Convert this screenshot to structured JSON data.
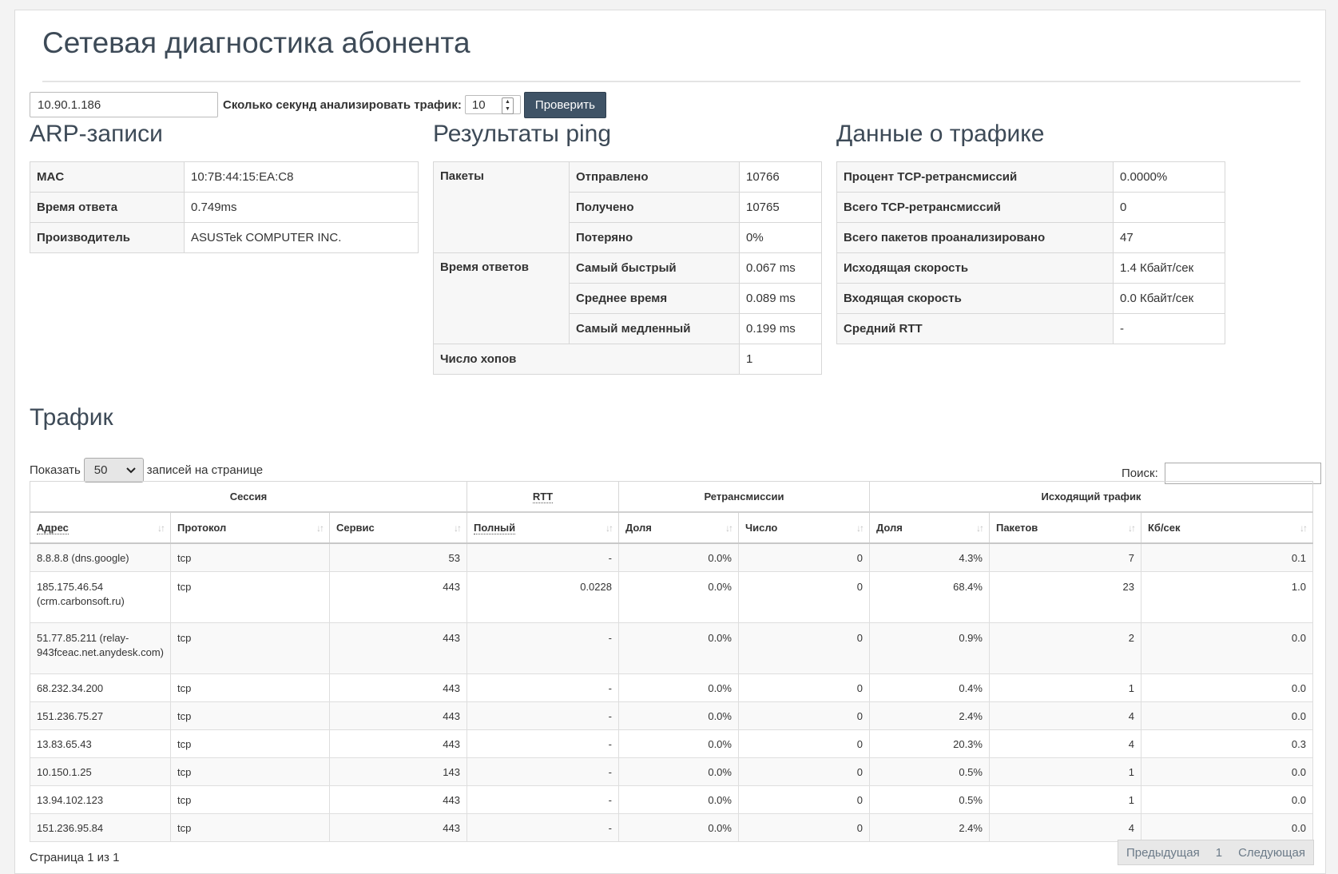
{
  "page": {
    "title": "Сетевая диагностика абонента"
  },
  "form": {
    "ip_value": "10.90.1.186",
    "seconds_label": "Сколько секунд анализировать трафик:",
    "seconds_value": "10",
    "check_label": "Проверить"
  },
  "arp": {
    "title": "ARP-записи",
    "rows": [
      {
        "label": "MAC",
        "value": "10:7B:44:15:EA:C8"
      },
      {
        "label": "Время ответа",
        "value": "0.749ms"
      },
      {
        "label": "Производитель",
        "value": "ASUSTek COMPUTER INC."
      }
    ]
  },
  "ping": {
    "title": "Результаты ping",
    "packets_label": "Пакеты",
    "sent_label": "Отправлено",
    "sent": "10766",
    "received_label": "Получено",
    "received": "10765",
    "lost_label": "Потеряно",
    "lost": "0%",
    "times_label": "Время ответов",
    "fastest_label": "Самый быстрый",
    "fastest": "0.067 ms",
    "avg_label": "Среднее время",
    "avg": "0.089 ms",
    "slowest_label": "Самый медленный",
    "slowest": "0.199 ms",
    "hops_label": "Число хопов",
    "hops": "1"
  },
  "trafficdata": {
    "title": "Данные о трафике",
    "rows": [
      {
        "label": "Процент TCP-ретрансмиссий",
        "value": "0.0000%"
      },
      {
        "label": "Всего TCP-ретрансмиссий",
        "value": "0"
      },
      {
        "label": "Всего пакетов проанализировано",
        "value": "47"
      },
      {
        "label": "Исходящая скорость",
        "value": "1.4 Кбайт/сек"
      },
      {
        "label": "Входящая скорость",
        "value": "0.0 Кбайт/сек"
      },
      {
        "label": "Средний RTT",
        "value": "-"
      }
    ]
  },
  "traffic": {
    "title": "Трафик",
    "show_label": "Показать",
    "length_value": "50",
    "per_page_label": "записей на странице",
    "search_label": "Поиск:",
    "groups": [
      "Сессия",
      "RTT",
      "Ретрансмиссии",
      "Исходящий трафик"
    ],
    "columns": [
      "Адрес",
      "Протокол",
      "Сервис",
      "Полный",
      "Доля",
      "Число",
      "Доля",
      "Пакетов",
      "Кб/сек"
    ],
    "rows": [
      {
        "addr": "8.8.8.8 (dns.google)",
        "proto": "tcp",
        "service": "53",
        "rtt": "-",
        "re_share": "0.0%",
        "re_count": "0",
        "out_share": "4.3%",
        "packets": "7",
        "kbps": "0.1"
      },
      {
        "addr": "185.175.46.54 (crm.carbonsoft.ru)",
        "proto": "tcp",
        "service": "443",
        "rtt": "0.0228",
        "re_share": "0.0%",
        "re_count": "0",
        "out_share": "68.4%",
        "packets": "23",
        "kbps": "1.0"
      },
      {
        "addr": "51.77.85.211 (relay-943fceac.net.anydesk.com)",
        "proto": "tcp",
        "service": "443",
        "rtt": "-",
        "re_share": "0.0%",
        "re_count": "0",
        "out_share": "0.9%",
        "packets": "2",
        "kbps": "0.0"
      },
      {
        "addr": "68.232.34.200",
        "proto": "tcp",
        "service": "443",
        "rtt": "-",
        "re_share": "0.0%",
        "re_count": "0",
        "out_share": "0.4%",
        "packets": "1",
        "kbps": "0.0"
      },
      {
        "addr": "151.236.75.27",
        "proto": "tcp",
        "service": "443",
        "rtt": "-",
        "re_share": "0.0%",
        "re_count": "0",
        "out_share": "2.4%",
        "packets": "4",
        "kbps": "0.0"
      },
      {
        "addr": "13.83.65.43",
        "proto": "tcp",
        "service": "443",
        "rtt": "-",
        "re_share": "0.0%",
        "re_count": "0",
        "out_share": "20.3%",
        "packets": "4",
        "kbps": "0.3"
      },
      {
        "addr": "10.150.1.25",
        "proto": "tcp",
        "service": "143",
        "rtt": "-",
        "re_share": "0.0%",
        "re_count": "0",
        "out_share": "0.5%",
        "packets": "1",
        "kbps": "0.0"
      },
      {
        "addr": "13.94.102.123",
        "proto": "tcp",
        "service": "443",
        "rtt": "-",
        "re_share": "0.0%",
        "re_count": "0",
        "out_share": "0.5%",
        "packets": "1",
        "kbps": "0.0"
      },
      {
        "addr": "151.236.95.84",
        "proto": "tcp",
        "service": "443",
        "rtt": "-",
        "re_share": "0.0%",
        "re_count": "0",
        "out_share": "2.4%",
        "packets": "4",
        "kbps": "0.0"
      }
    ],
    "info": "Страница 1 из 1",
    "prev_label": "Предыдущая",
    "page_number": "1",
    "next_label": "Следующая"
  }
}
